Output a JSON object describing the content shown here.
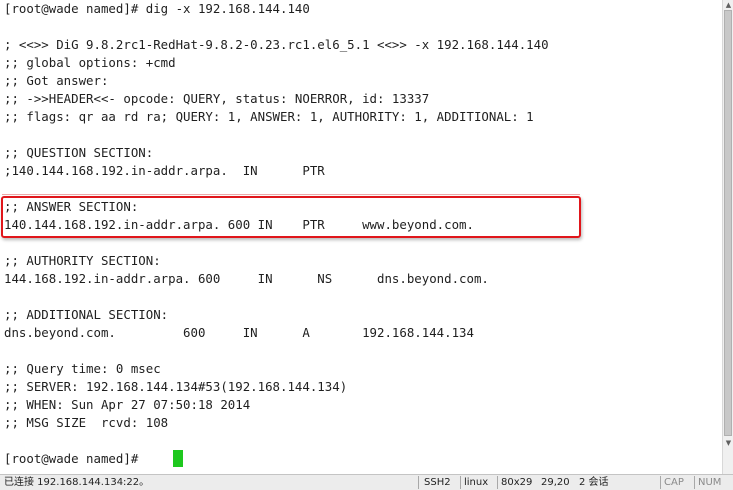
{
  "terminal": {
    "lines": [
      "[root@wade named]# dig -x 192.168.144.140",
      "",
      "; <<>> DiG 9.8.2rc1-RedHat-9.8.2-0.23.rc1.el6_5.1 <<>> -x 192.168.144.140",
      ";; global options: +cmd",
      ";; Got answer:",
      ";; ->>HEADER<<- opcode: QUERY, status: NOERROR, id: 13337",
      ";; flags: qr aa rd ra; QUERY: 1, ANSWER: 1, AUTHORITY: 1, ADDITIONAL: 1",
      "",
      ";; QUESTION SECTION:",
      ";140.144.168.192.in-addr.arpa.  IN      PTR",
      "",
      ";; ANSWER SECTION:",
      "140.144.168.192.in-addr.arpa. 600 IN    PTR     www.beyond.com.",
      "",
      ";; AUTHORITY SECTION:",
      "144.168.192.in-addr.arpa. 600     IN      NS      dns.beyond.com.",
      "",
      ";; ADDITIONAL SECTION:",
      "dns.beyond.com.         600     IN      A       192.168.144.134",
      "",
      ";; Query time: 0 msec",
      ";; SERVER: 192.168.144.134#53(192.168.144.134)",
      ";; WHEN: Sun Apr 27 07:50:18 2014",
      ";; MSG SIZE  rcvd: 108",
      "",
      "[root@wade named]# "
    ],
    "cursor_color": "#1ec81e",
    "highlight_color": "#e0161b"
  },
  "statusbar": {
    "connection": "已连接 192.168.144.134:22。",
    "protocol": "SSH2",
    "os": "linux",
    "size": "80x29",
    "position": "29,20",
    "sessions": "2 会话",
    "caps": "CAP",
    "num": "NUM"
  }
}
